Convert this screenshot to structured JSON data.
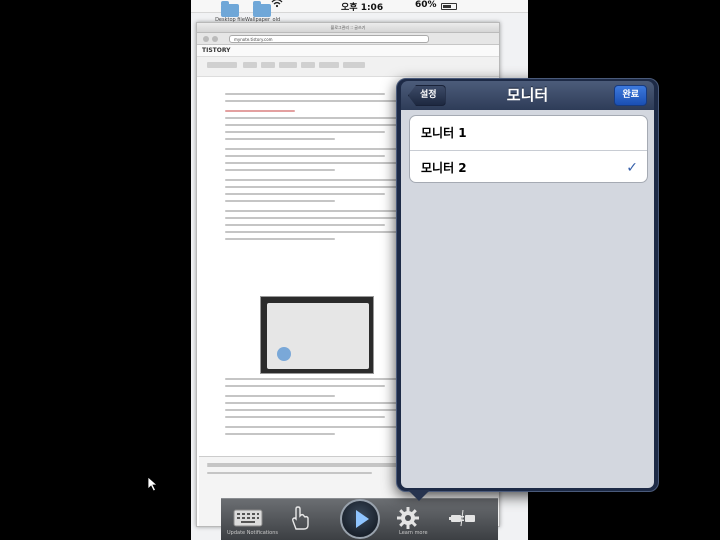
{
  "status_bar": {
    "time": "오후 1:06",
    "battery_pct": "60%"
  },
  "desktop": {
    "folders": [
      {
        "label": "Desktop file"
      },
      {
        "label": "Wallpaper_old file"
      }
    ]
  },
  "browser": {
    "url": "mynote.tistory.com",
    "blog_logo": "TISTORY",
    "window_title": "블로그관리 :: 글쓰기",
    "form_buttons": [
      "미리보기",
      "임시저장",
      "저장하기"
    ]
  },
  "popover": {
    "title": "모니터",
    "back_label": "설정",
    "done_label": "완료",
    "monitors": [
      {
        "label": "모니터 1",
        "selected": false
      },
      {
        "label": "모니터 2",
        "selected": true
      }
    ]
  },
  "app_toolbar": {
    "items": [
      {
        "icon": "keyboard-icon",
        "label": "Update Notifications"
      },
      {
        "icon": "touch-hand-icon",
        "label": ""
      },
      {
        "icon": "play-icon",
        "label": ""
      },
      {
        "icon": "gear-icon",
        "label": "Learn more"
      },
      {
        "icon": "disconnect-plug-icon",
        "label": ""
      }
    ]
  },
  "colors": {
    "popover_nav": "#2e3c58",
    "done_button": "#1a4fb3",
    "checkmark": "#345ea9",
    "popover_body": "#d3d7df"
  }
}
